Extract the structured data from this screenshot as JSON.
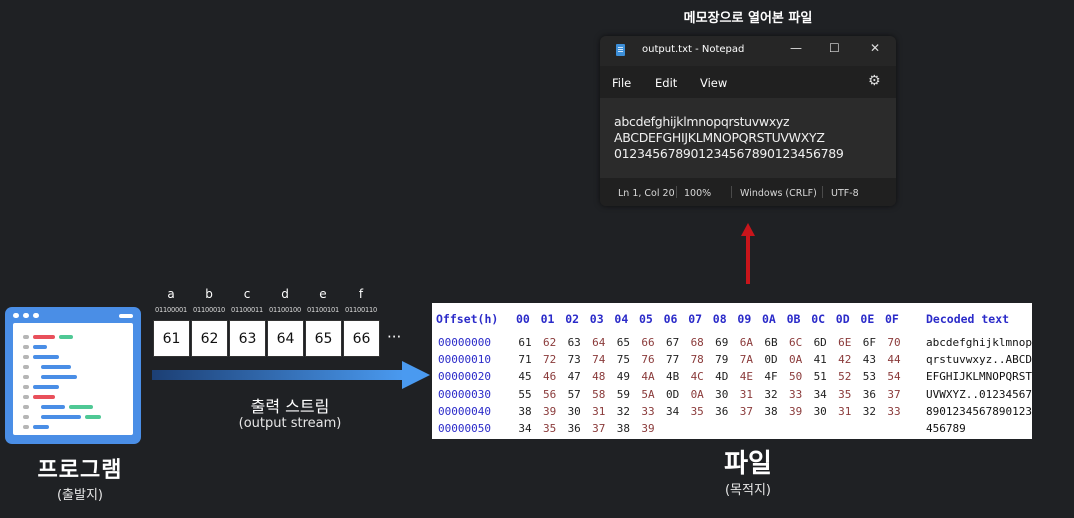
{
  "program": {
    "title": "프로그램",
    "subtitle": "(출발지)"
  },
  "stream": {
    "letters": [
      "a",
      "b",
      "c",
      "d",
      "e",
      "f"
    ],
    "bits": [
      "01100001",
      "01100010",
      "01100011",
      "01100100",
      "01100101",
      "01100110"
    ],
    "bytes": [
      "61",
      "62",
      "63",
      "64",
      "65",
      "66"
    ],
    "ellipsis": "···",
    "title": "출력 스트림",
    "subtitle": "(output stream)"
  },
  "hex": {
    "offset_header": "Offset(h)",
    "column_headers": [
      "00",
      "01",
      "02",
      "03",
      "04",
      "05",
      "06",
      "07",
      "08",
      "09",
      "0A",
      "0B",
      "0C",
      "0D",
      "0E",
      "0F"
    ],
    "decoded_header": "Decoded text",
    "rows": [
      {
        "offset": "00000000",
        "bytes": [
          "61",
          "62",
          "63",
          "64",
          "65",
          "66",
          "67",
          "68",
          "69",
          "6A",
          "6B",
          "6C",
          "6D",
          "6E",
          "6F",
          "70"
        ],
        "decoded": "abcdefghijklmnop"
      },
      {
        "offset": "00000010",
        "bytes": [
          "71",
          "72",
          "73",
          "74",
          "75",
          "76",
          "77",
          "78",
          "79",
          "7A",
          "0D",
          "0A",
          "41",
          "42",
          "43",
          "44"
        ],
        "decoded": "qrstuvwxyz..ABCD"
      },
      {
        "offset": "00000020",
        "bytes": [
          "45",
          "46",
          "47",
          "48",
          "49",
          "4A",
          "4B",
          "4C",
          "4D",
          "4E",
          "4F",
          "50",
          "51",
          "52",
          "53",
          "54"
        ],
        "decoded": "EFGHIJKLMNOPQRST"
      },
      {
        "offset": "00000030",
        "bytes": [
          "55",
          "56",
          "57",
          "58",
          "59",
          "5A",
          "0D",
          "0A",
          "30",
          "31",
          "32",
          "33",
          "34",
          "35",
          "36",
          "37"
        ],
        "decoded": "UVWXYZ..01234567"
      },
      {
        "offset": "00000040",
        "bytes": [
          "38",
          "39",
          "30",
          "31",
          "32",
          "33",
          "34",
          "35",
          "36",
          "37",
          "38",
          "39",
          "30",
          "31",
          "32",
          "33"
        ],
        "decoded": "8901234567890123"
      },
      {
        "offset": "00000050",
        "bytes": [
          "34",
          "35",
          "36",
          "37",
          "38",
          "39"
        ],
        "decoded": "456789"
      }
    ],
    "byte_colors": {
      "even": "#222222",
      "odd": "#8a3a3a"
    }
  },
  "file": {
    "title": "파일",
    "subtitle": "(목적지)"
  },
  "notepad": {
    "caption": "메모장으로 열어본 파일",
    "window_title": "output.txt - Notepad",
    "controls": {
      "minimize": "—",
      "maximize": "☐",
      "close": "✕"
    },
    "menu": [
      "File",
      "Edit",
      "View"
    ],
    "settings_icon": "⚙",
    "lines": [
      "abcdefghijklmnopqrstuvwxyz",
      "ABCDEFGHIJKLMNOPQRSTUVWXYZ",
      "01234567890123456789012345678​9"
    ],
    "status": {
      "position": "Ln 1, Col 20",
      "zoom": "100%",
      "line_ending": "Windows (CRLF)",
      "encoding": "UTF-8"
    }
  },
  "colors": {
    "background": "#1f2124",
    "program_blue": "#4a8ee6",
    "stream_arrow": "#3b8be0",
    "up_arrow": "#c8151b",
    "hex_header": "#2b2bc9"
  }
}
